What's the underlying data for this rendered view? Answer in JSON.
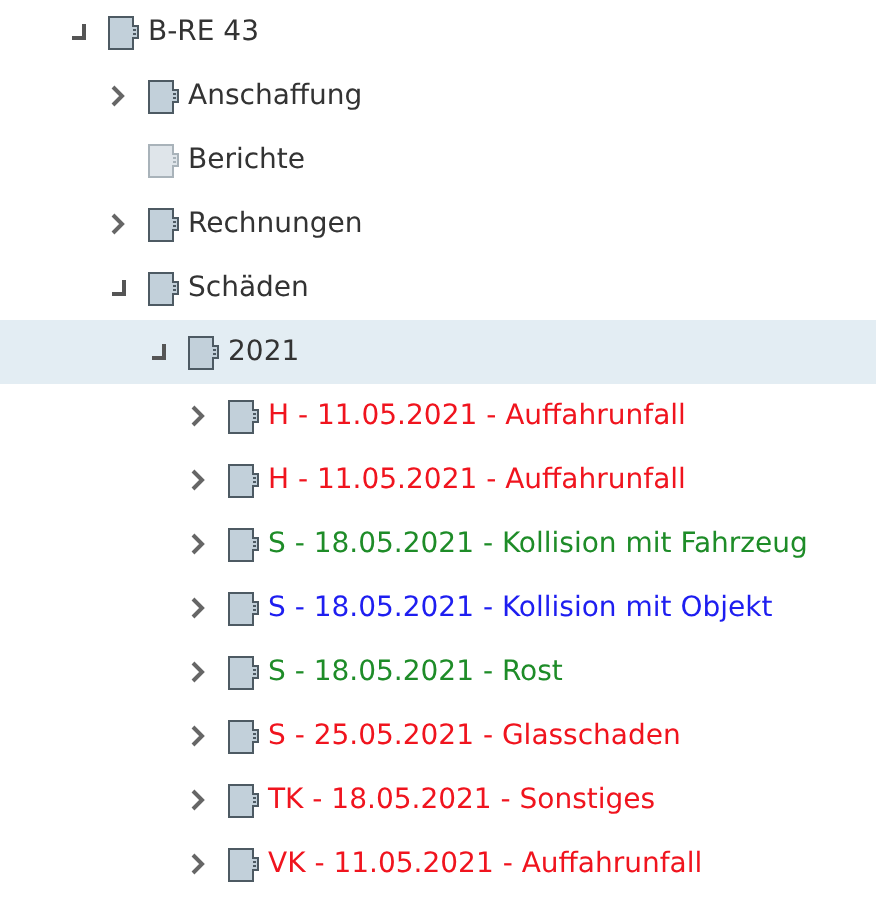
{
  "tree": [
    {
      "label": "B-RE 43",
      "kind": "folder",
      "expanded": true,
      "selected": false,
      "children": [
        {
          "label": "Anschaffung",
          "kind": "folder",
          "expanded": false,
          "selected": false
        },
        {
          "label": "Berichte",
          "kind": "empty",
          "selected": false
        },
        {
          "label": "Rechnungen",
          "kind": "folder",
          "expanded": false,
          "selected": false
        },
        {
          "label": "Schäden",
          "kind": "folder",
          "expanded": true,
          "selected": false,
          "children": [
            {
              "label": "2021",
              "kind": "folder",
              "expanded": true,
              "selected": true,
              "children": [
                {
                  "label": "H - 11.05.2021 - Auffahrunfall",
                  "kind": "folder",
                  "expanded": false,
                  "selected": false,
                  "color": "#f0141e"
                },
                {
                  "label": "H - 11.05.2021 - Auffahrunfall",
                  "kind": "folder",
                  "expanded": false,
                  "selected": false,
                  "color": "#f0141e"
                },
                {
                  "label": "S - 18.05.2021 - Kollision mit Fahrzeug",
                  "kind": "folder",
                  "expanded": false,
                  "selected": false,
                  "color": "#1e8c28"
                },
                {
                  "label": "S - 18.05.2021 - Kollision mit Objekt",
                  "kind": "folder",
                  "expanded": false,
                  "selected": false,
                  "color": "#1e1ef0"
                },
                {
                  "label": "S - 18.05.2021 - Rost",
                  "kind": "folder",
                  "expanded": false,
                  "selected": false,
                  "color": "#1e8c28"
                },
                {
                  "label": "S - 25.05.2021 - Glasschaden",
                  "kind": "folder",
                  "expanded": false,
                  "selected": false,
                  "color": "#f0141e"
                },
                {
                  "label": "TK - 18.05.2021 - Sonstiges",
                  "kind": "folder",
                  "expanded": false,
                  "selected": false,
                  "color": "#f0141e"
                },
                {
                  "label": "VK - 11.05.2021 - Auffahrunfall",
                  "kind": "folder",
                  "expanded": false,
                  "selected": false,
                  "color": "#f0141e"
                }
              ]
            }
          ]
        }
      ]
    }
  ]
}
